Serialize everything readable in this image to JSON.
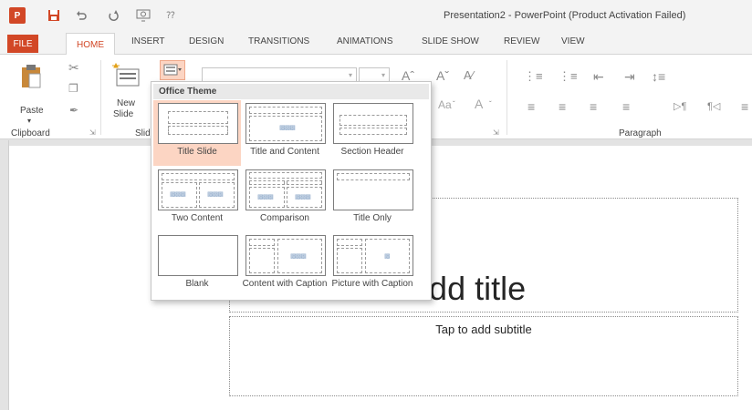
{
  "window": {
    "app_logo_text": "P",
    "title": "Presentation2 - PowerPoint (Product Activation Failed)"
  },
  "qat": {
    "save_icon": "save-icon",
    "undo_icon": "undo-icon",
    "redo_icon": "redo-icon",
    "slideshow_icon": "start-from-beginning-icon",
    "customize_icon": "customize-qat-icon"
  },
  "tabs": [
    "FILE",
    "HOME",
    "INSERT",
    "DESIGN",
    "TRANSITIONS",
    "ANIMATIONS",
    "SLIDE SHOW",
    "REVIEW",
    "VIEW"
  ],
  "ribbon": {
    "clipboard": {
      "paste_label": "Paste",
      "group_label": "Clipboard"
    },
    "slides": {
      "new_slide_label": "New",
      "new_slide_label2": "Slide",
      "group_label_partial": "Slid"
    },
    "font": {
      "change_case_label": "Aa",
      "font_color_label": "A"
    },
    "paragraph": {
      "group_label": "Paragraph"
    }
  },
  "layout_menu": {
    "header": "Office Theme",
    "layouts": [
      {
        "name": "Title Slide",
        "selected": true
      },
      {
        "name": "Title and Content"
      },
      {
        "name": "Section Header"
      },
      {
        "name": "Two Content"
      },
      {
        "name": "Comparison"
      },
      {
        "name": "Title Only"
      },
      {
        "name": "Blank"
      },
      {
        "name": "Content with Caption"
      },
      {
        "name": "Picture with Caption"
      }
    ]
  },
  "slide": {
    "title_placeholder": "to add title",
    "subtitle_placeholder": "Tap to add subtitle"
  },
  "colors": {
    "accent": "#d24726",
    "selected_layout_bg": "#fcd5c3"
  }
}
